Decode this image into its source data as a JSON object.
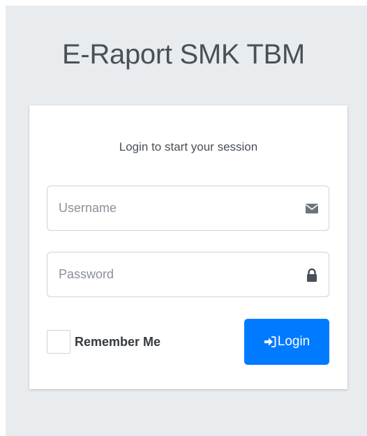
{
  "app_title": "E-Raport SMK TBM",
  "login_box": {
    "subtitle": "Login to start your session",
    "username": {
      "placeholder": "Username",
      "value": "",
      "icon": "envelope-icon"
    },
    "password": {
      "placeholder": "Password",
      "value": "",
      "icon": "lock-icon"
    },
    "remember": {
      "label": "Remember Me",
      "checked": false
    },
    "login_button": {
      "label": "Login",
      "icon": "sign-in-icon"
    }
  },
  "colors": {
    "page_background": "#e9ecef",
    "card_background": "#ffffff",
    "primary": "#007bff",
    "text": "#495057"
  }
}
